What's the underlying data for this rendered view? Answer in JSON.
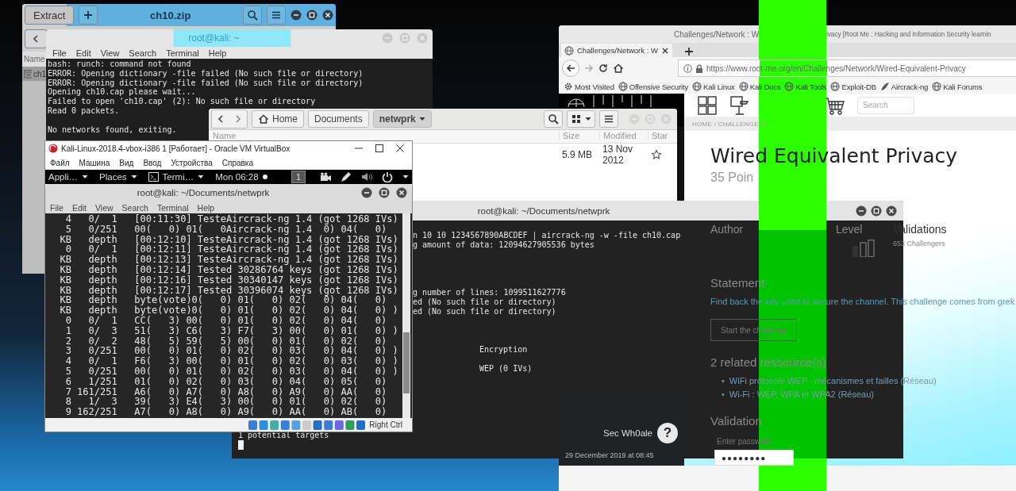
{
  "archive_window": {
    "extract_button": "Extract",
    "title": "ch10.zip",
    "column": "Name",
    "files": [
      {
        "name": "ch1",
        "selected": true
      }
    ]
  },
  "home_terminal": {
    "title": "root@kali: ~",
    "menu": [
      "File",
      "Edit",
      "View",
      "Search",
      "Terminal",
      "Help"
    ],
    "blocks": [
      [
        "bash: runch: command not found",
        "ERROR: Opening dictionary -file failed (No such file or directory)",
        "ERROR: Opening dictionary -file failed (No such file or directory)",
        "Opening ch10.cap please wait...",
        "Failed to open 'ch10.cap' (2): No such file or directory",
        "Read 0 packets."
      ],
      [
        "No networks found, exiting."
      ]
    ]
  },
  "browser": {
    "title_parts": [
      "Challenges/Network : W",
      "ivacy [Root Me : Hacking and Information Security learnin"
    ],
    "tab": "Challenges/Network : W",
    "url": "https://www.root-me.org/en/Challenges/Network/Wired-Equivalent-Privacy",
    "bookmarks": [
      {
        "label": "Most Visited",
        "kind": "gear"
      },
      {
        "label": "Offensive Security",
        "kind": "globe"
      },
      {
        "label": "Kali Linux",
        "kind": "globe"
      },
      {
        "label": "Kali Docs",
        "kind": "globe"
      },
      {
        "label": "Kali Tools",
        "kind": "globe"
      },
      {
        "label": "Exploit-DB",
        "kind": "globe"
      },
      {
        "label": "Aircrack-ng",
        "kind": "wing"
      },
      {
        "label": "Kali Forums",
        "kind": "globe"
      }
    ],
    "search_placeholder": "Search",
    "breadcrumb": "HOME / CHALLENGES /",
    "heading": "Wired Equivalent Privacy",
    "points": "35 Poin",
    "stats": [
      {
        "label": "Author"
      },
      {
        "label": "Level"
      },
      {
        "label": "Validations",
        "value": "653 Challengers"
      }
    ],
    "statement_title": "Statement",
    "statement": "Find back the key used to secure the channel. This challenge comes from grek",
    "start_button": "Start the challenge",
    "resources_title": "2 related ressource(s)",
    "resources": [
      {
        "marker": "•",
        "label": "WiFi protocole WEP : mécanismes et failles (Réseau)"
      },
      {
        "marker": "•",
        "label": "Wi-Fi : WEP, WPA et WPA2 (Réseau)"
      }
    ],
    "validation_title": "Validation",
    "password_label": "Enter password",
    "password_value": "●●●●●●●●",
    "comment": {
      "author": "Sec Wh0ale",
      "avatar_mark": "?",
      "date": "29 December 2019 at 08:45"
    }
  },
  "files_window": {
    "path": [
      {
        "label": "Home",
        "selected": false
      },
      {
        "label": "Documents",
        "selected": false
      },
      {
        "label": "netwprk",
        "selected": true
      }
    ],
    "columns": [
      "Name",
      "Size",
      "Modified",
      "Star"
    ],
    "rows": [
      {
        "size": "5.9 MB",
        "modified": "13 Nov 2012",
        "starred": false
      }
    ]
  },
  "big_terminal": {
    "title": "root@kali: ~/Documents/netwprk",
    "lines": [
      {
        "kind": "cut",
        "text": "n 10 10 1234567890ABCDEF | aircrack-ng -w -file ch10.cap"
      },
      {
        "kind": "cut",
        "text": "g amount of data: 12094627905536 bytes"
      },
      {
        "kind": "gap"
      },
      {
        "kind": "gap"
      },
      {
        "kind": "gap"
      },
      {
        "kind": "gap"
      },
      {
        "kind": "cut",
        "text": "g number of lines: 1099511627776"
      },
      {
        "kind": "cut",
        "text": "ed (No such file or directory)"
      },
      {
        "kind": "cut",
        "text": "ed (No such file or directory)"
      },
      {
        "kind": "gap"
      },
      {
        "kind": "gap"
      },
      {
        "kind": "gap"
      },
      {
        "kind": "column",
        "text": "Encryption"
      },
      {
        "kind": "gap"
      },
      {
        "kind": "column",
        "text": "WEP (0 IVs)"
      },
      {
        "kind": "gap"
      },
      {
        "kind": "gap"
      },
      {
        "kind": "gap"
      },
      {
        "kind": "gap"
      },
      {
        "kind": "gap"
      },
      {
        "kind": "gap"
      },
      {
        "kind": "full",
        "text": "1 potential targets"
      },
      {
        "kind": "cursor"
      }
    ]
  },
  "vbox_window": {
    "title": "Kali-Linux-2018.4-vbox-i386 1 [Работает] - Oracle VM VirtualBox",
    "menu": [
      "Файл",
      "Машина",
      "Вид",
      "Ввод",
      "Устройства",
      "Справка"
    ],
    "panel": {
      "apps": "Appli…",
      "places": "Places",
      "terminal": "Termi…",
      "clock": "Mon 06:28",
      "workspace": "1"
    },
    "terminal": {
      "title": "root@kali: ~/Documents/netwprk",
      "menu": [
        "File",
        "Edit",
        "View",
        "Search",
        "Terminal",
        "Help"
      ],
      "lines": [
        "   4   0/  1   [00:11:30] TesteAircrack-ng 1.4 (got 1268 IVs)",
        "   5   0/251   00(   0) 01(   0Aircrack-ng 1.4  0) 04(   0)",
        "  KB   depth   [00:12:10] TesteAircrack-ng 1.4 (got 1268 IVs)",
        "   0   0/  1   [00:12:11] TesteAircrack-ng 1.4 (got 1268 IVs)",
        "  KB   depth   [00:12:13] TesteAircrack-ng 1.4 (got 1268 IVs)",
        "  KB   depth   [00:12:14] Tested 30286764 keys (got 1268 IVs)",
        "  KB   depth   [00:12:16] Tested 30340147 keys (got 1268 IVs)",
        "  KB   depth   [00:12:17] Tested 30396074 keys (got 1268 IVs)",
        "  KB   depth   byte(vote)0(   0) 01(   0) 02(   0) 04(   0)",
        "  KB   depth   byte(vote)0(   0) 01(   0) 02(   0) 04(   0) )",
        "   0   0/  1   CC(   3) 00(   0) 01(   0) 02(   0) 04(   0)",
        "   1   0/  3   51(   3) C6(   3) F7(   3) 00(   0) 01(   0) )",
        "   2   0/  2   48(   5) 59(   5) 00(   0) 01(   0) 02(   0)",
        "   3   0/251   00(   0) 01(   0) 02(   0) 03(   0) 04(   0) )",
        "   4   0/  1   F6(   3) 00(   0) 01(   0) 02(   0) 03(   0) )",
        "   5   0/251   00(   0) 01(   0) 02(   0) 03(   0) 04(   0) )",
        "   6   1/251   01(   0) 02(   0) 03(   0) 04(   0) 05(   0)",
        "   7 161/251   A6(   0) A7(   0) A8(   0) A9(   0) AA(   0)",
        "   8   1/  3   39(   3) E4(   3) 00(   0) 01(   0) 02(   0)",
        "   9 162/251   A7(   0) A8(   0) A9(   0) AA(   0) AB(   0)"
      ]
    },
    "host_key": "Right Ctrl"
  }
}
